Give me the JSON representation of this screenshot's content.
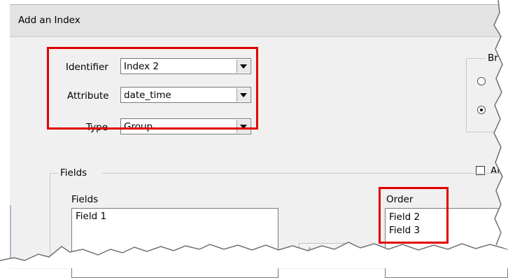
{
  "window": {
    "title": "Add an Index"
  },
  "form": {
    "identifier_label": "Identifier",
    "identifier_value": "Index 2",
    "attribute_label": "Attribute",
    "attribute_value": "date_time",
    "type_label": "Type",
    "type_value": "Group"
  },
  "right_panel": {
    "group_label_fragment": "Br",
    "checkbox_label_fragment": "All"
  },
  "fields_group": {
    "group_label": "Fields",
    "fields_list_label": "Fields",
    "fields_items": [
      "Field 1"
    ],
    "add_button_label": "Add >>",
    "order_list_label": "Order",
    "order_items": [
      "Field 2",
      "Field 3"
    ]
  },
  "colors": {
    "highlight": "#e00000",
    "dialog_bg": "#f0f0f0"
  }
}
